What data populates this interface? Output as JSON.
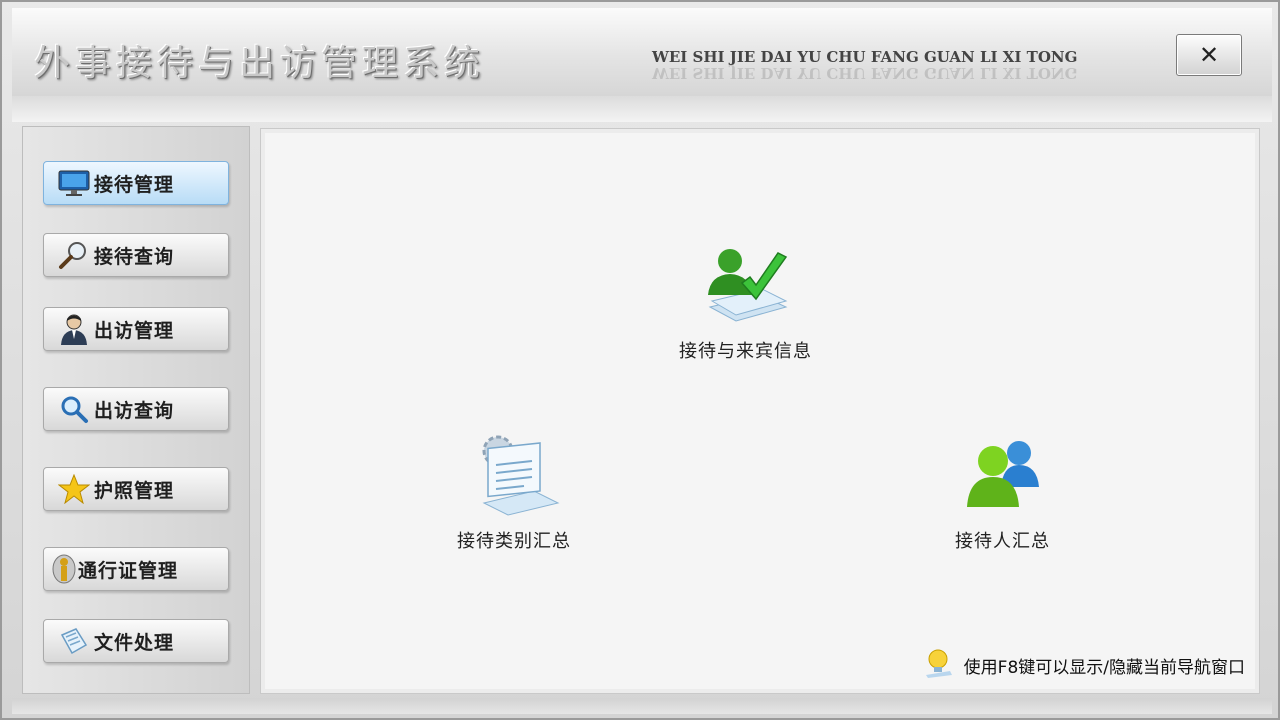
{
  "header": {
    "title": "外事接待与出访管理系统",
    "pinyin": "WEI SHI JIE DAI YU CHU FANG GUAN  LI  XI  TONG",
    "close_label": "✕"
  },
  "sidebar": {
    "items": [
      {
        "label": "接待管理",
        "icon": "monitor-icon",
        "active": true
      },
      {
        "label": "接待查询",
        "icon": "magnifier-icon",
        "active": false
      },
      {
        "label": "出访管理",
        "icon": "person-suit-icon",
        "active": false
      },
      {
        "label": "出访查询",
        "icon": "search-icon",
        "active": false
      },
      {
        "label": "护照管理",
        "icon": "star-icon",
        "active": false
      },
      {
        "label": "通行证管理",
        "icon": "badge-icon",
        "active": false
      },
      {
        "label": "文件处理",
        "icon": "document-icon",
        "active": false
      }
    ]
  },
  "main": {
    "tiles": [
      {
        "label": "接待与来宾信息",
        "icon": "user-check-icon"
      },
      {
        "label": "接待类别汇总",
        "icon": "document-gear-icon"
      },
      {
        "label": "接待人汇总",
        "icon": "users-group-icon"
      }
    ],
    "hint": "使用F8键可以显示/隐藏当前导航窗口"
  },
  "colors": {
    "active_nav": "#b8dcf6",
    "panel_bg": "#f5f5f5",
    "accent_green": "#3aa12a",
    "accent_blue": "#2a7fd0"
  }
}
